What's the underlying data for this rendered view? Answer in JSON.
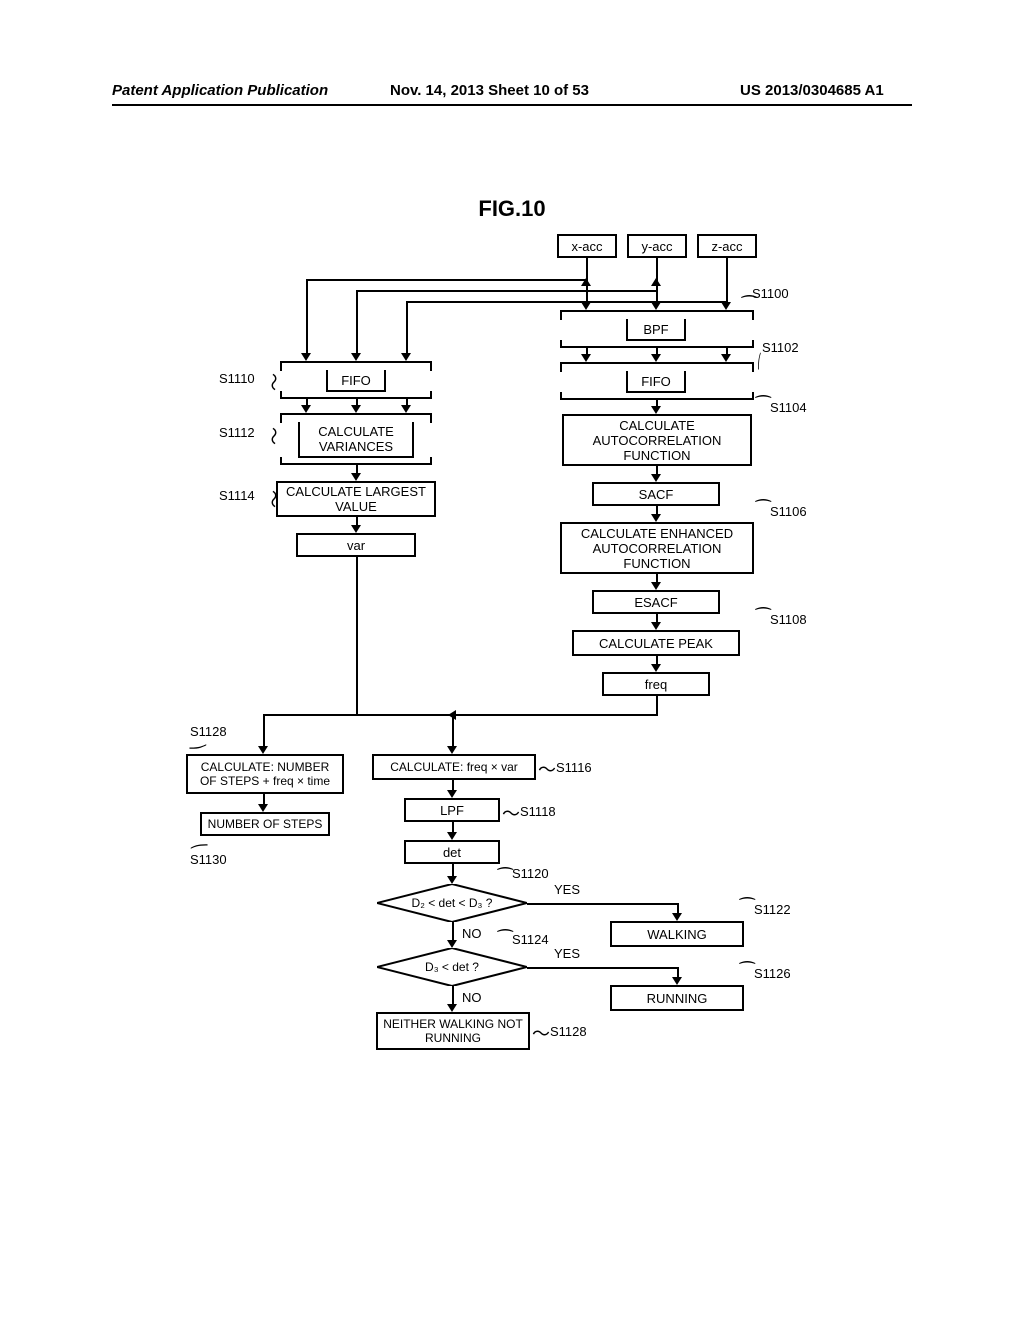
{
  "header": {
    "left": "Patent Application Publication",
    "mid": "Nov. 14, 2013  Sheet 10 of 53",
    "right": "US 2013/0304685 A1"
  },
  "figure_title": "FIG.10",
  "inputs": {
    "x": "x-acc",
    "y": "y-acc",
    "z": "z-acc"
  },
  "right_branch": {
    "bpf": "BPF",
    "fifo": "FIFO",
    "autocorr": "CALCULATE AUTOCORRELATION FUNCTION",
    "sacf": "SACF",
    "enh_autocorr": "CALCULATE ENHANCED AUTOCORRELATION FUNCTION",
    "esacf": "ESACF",
    "calc_peak": "CALCULATE PEAK",
    "freq": "freq"
  },
  "left_branch": {
    "fifo": "FIFO",
    "variances": "CALCULATE VARIANCES",
    "largest": "CALCULATE LARGEST VALUE",
    "var": "var"
  },
  "center_branch": {
    "fxv": "CALCULATE: freq × var",
    "lpf": "LPF",
    "det": "det",
    "dec1": "D₂ < det < D₃ ?",
    "walking": "WALKING",
    "dec2": "D₃ < det ?",
    "running": "RUNNING",
    "neither": "NEITHER WALKING NOT RUNNING",
    "yes": "YES",
    "no": "NO"
  },
  "far_left": {
    "steps_calc": "CALCULATE: NUMBER OF STEPS + freq × time",
    "steps": "NUMBER OF STEPS"
  },
  "step_labels": {
    "s1100": "S1100",
    "s1102": "S1102",
    "s1104": "S1104",
    "s1106": "S1106",
    "s1108": "S1108",
    "s1110": "S1110",
    "s1112": "S1112",
    "s1114": "S1114",
    "s1116": "S1116",
    "s1118": "S1118",
    "s1120": "S1120",
    "s1122": "S1122",
    "s1124": "S1124",
    "s1126": "S1126",
    "s1128_a": "S1128",
    "s1128_b": "S1128",
    "s1130": "S1130"
  }
}
